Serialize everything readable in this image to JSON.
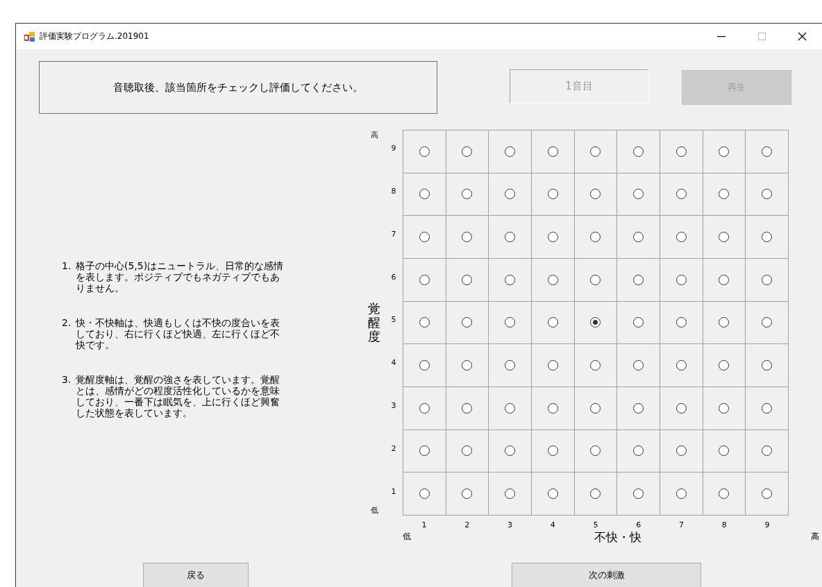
{
  "window": {
    "title": "評価実験プログラム.201901"
  },
  "instruction": "音聴取後、該当箇所をチェックし評価してください。",
  "sound_field": {
    "value": "1音目",
    "disabled": true
  },
  "play_button": {
    "label": "再生",
    "disabled": true
  },
  "notes": [
    {
      "number": "1.",
      "text": "格子の中心(5,5)はニュートラル、日常的な感情を表します。ポジティブでもネガティブでもありません。"
    },
    {
      "number": "2.",
      "text": "快・不快軸は、快適もしくは不快の度合いを表しており、右に行くほど快適、左に行くほど不快です。"
    },
    {
      "number": "3.",
      "text": "覚醒度軸は、覚醒の強さを表しています。覚醒とは、感情がどの程度活性化しているかを意味しており、一番下は眠気を、上に行くほど興奮した状態を表しています。"
    }
  ],
  "grid": {
    "y_title": "覚醒度",
    "y_high": "高",
    "y_low": "低",
    "x_title": "不快・快",
    "x_low": "低",
    "x_high": "高",
    "columns": [
      "1",
      "2",
      "3",
      "4",
      "5",
      "6",
      "7",
      "8",
      "9"
    ],
    "rows": [
      {
        "label": "9",
        "cells": [
          {
            "selected": false
          },
          {
            "selected": false
          },
          {
            "selected": false
          },
          {
            "selected": false
          },
          {
            "selected": false
          },
          {
            "selected": false
          },
          {
            "selected": false
          },
          {
            "selected": false
          },
          {
            "selected": false
          }
        ]
      },
      {
        "label": "8",
        "cells": [
          {
            "selected": false
          },
          {
            "selected": false
          },
          {
            "selected": false
          },
          {
            "selected": false
          },
          {
            "selected": false
          },
          {
            "selected": false
          },
          {
            "selected": false
          },
          {
            "selected": false
          },
          {
            "selected": false
          }
        ]
      },
      {
        "label": "7",
        "cells": [
          {
            "selected": false
          },
          {
            "selected": false
          },
          {
            "selected": false
          },
          {
            "selected": false
          },
          {
            "selected": false
          },
          {
            "selected": false
          },
          {
            "selected": false
          },
          {
            "selected": false
          },
          {
            "selected": false
          }
        ]
      },
      {
        "label": "6",
        "cells": [
          {
            "selected": false
          },
          {
            "selected": false
          },
          {
            "selected": false
          },
          {
            "selected": false
          },
          {
            "selected": false
          },
          {
            "selected": false
          },
          {
            "selected": false
          },
          {
            "selected": false
          },
          {
            "selected": false
          }
        ]
      },
      {
        "label": "5",
        "cells": [
          {
            "selected": false
          },
          {
            "selected": false
          },
          {
            "selected": false
          },
          {
            "selected": false
          },
          {
            "selected": true
          },
          {
            "selected": false
          },
          {
            "selected": false
          },
          {
            "selected": false
          },
          {
            "selected": false
          }
        ]
      },
      {
        "label": "4",
        "cells": [
          {
            "selected": false
          },
          {
            "selected": false
          },
          {
            "selected": false
          },
          {
            "selected": false
          },
          {
            "selected": false
          },
          {
            "selected": false
          },
          {
            "selected": false
          },
          {
            "selected": false
          },
          {
            "selected": false
          }
        ]
      },
      {
        "label": "3",
        "cells": [
          {
            "selected": false
          },
          {
            "selected": false
          },
          {
            "selected": false
          },
          {
            "selected": false
          },
          {
            "selected": false
          },
          {
            "selected": false
          },
          {
            "selected": false
          },
          {
            "selected": false
          },
          {
            "selected": false
          }
        ]
      },
      {
        "label": "2",
        "cells": [
          {
            "selected": false
          },
          {
            "selected": false
          },
          {
            "selected": false
          },
          {
            "selected": false
          },
          {
            "selected": false
          },
          {
            "selected": false
          },
          {
            "selected": false
          },
          {
            "selected": false
          },
          {
            "selected": false
          }
        ]
      },
      {
        "label": "1",
        "cells": [
          {
            "selected": false
          },
          {
            "selected": false
          },
          {
            "selected": false
          },
          {
            "selected": false
          },
          {
            "selected": false
          },
          {
            "selected": false
          },
          {
            "selected": false
          },
          {
            "selected": false
          },
          {
            "selected": false
          }
        ]
      }
    ]
  },
  "back_button": {
    "label": "戻る"
  },
  "next_button": {
    "label": "次の刺激"
  }
}
